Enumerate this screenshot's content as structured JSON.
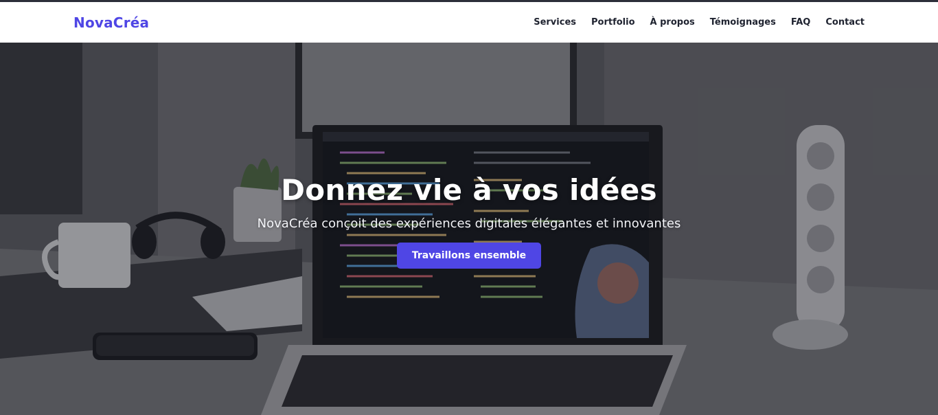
{
  "brand": {
    "name": "NovaCréa"
  },
  "nav": {
    "items": [
      {
        "label": "Services"
      },
      {
        "label": "Portfolio"
      },
      {
        "label": "À propos"
      },
      {
        "label": "Témoignages"
      },
      {
        "label": "FAQ"
      },
      {
        "label": "Contact"
      }
    ]
  },
  "hero": {
    "title": "Donnez vie à vos idées",
    "subtitle": "NovaCréa conçoit des expériences digitales élégantes et innovantes",
    "cta_label": "Travaillons ensemble",
    "background": "laptop-desk-photo"
  },
  "colors": {
    "accent": "#4f46e5",
    "nav_text": "#1f2330",
    "nav_bg": "#ffffff"
  }
}
